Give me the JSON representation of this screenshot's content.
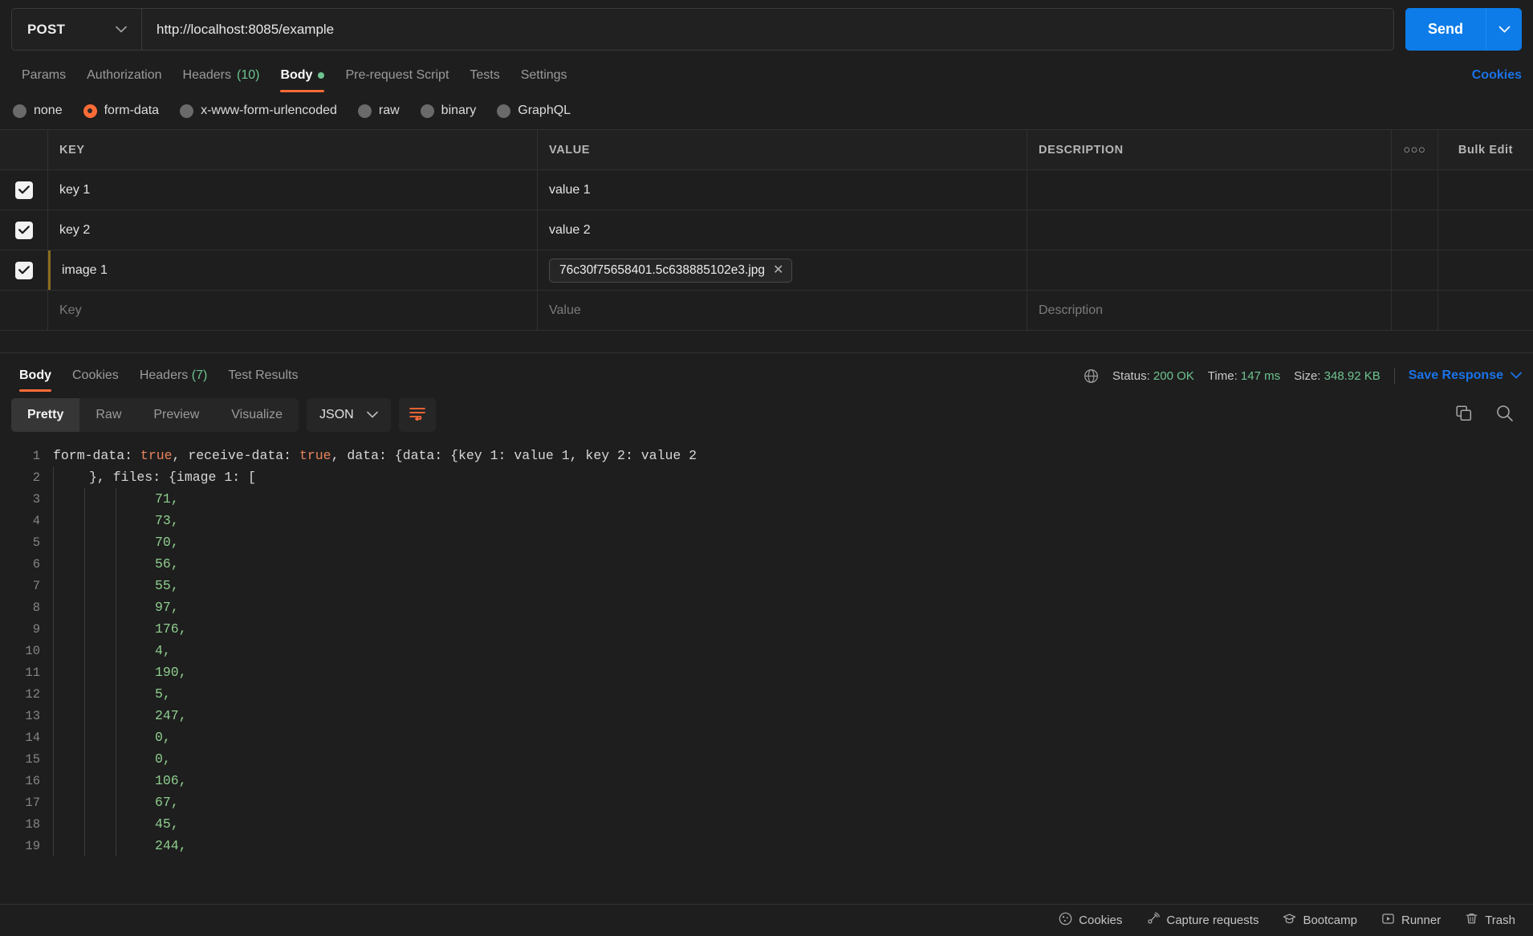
{
  "request": {
    "method": "POST",
    "url": "http://localhost:8085/example",
    "send_label": "Send",
    "tabs": [
      {
        "label": "Params",
        "count": "",
        "active": false,
        "dot": false
      },
      {
        "label": "Authorization",
        "count": "",
        "active": false,
        "dot": false
      },
      {
        "label": "Headers",
        "count": "(10)",
        "active": false,
        "dot": false
      },
      {
        "label": "Body",
        "count": "",
        "active": true,
        "dot": true
      },
      {
        "label": "Pre-request Script",
        "count": "",
        "active": false,
        "dot": false
      },
      {
        "label": "Tests",
        "count": "",
        "active": false,
        "dot": false
      },
      {
        "label": "Settings",
        "count": "",
        "active": false,
        "dot": false
      }
    ],
    "cookies_link": "Cookies",
    "body_types": [
      {
        "label": "none",
        "selected": false
      },
      {
        "label": "form-data",
        "selected": true
      },
      {
        "label": "x-www-form-urlencoded",
        "selected": false
      },
      {
        "label": "raw",
        "selected": false
      },
      {
        "label": "binary",
        "selected": false
      },
      {
        "label": "GraphQL",
        "selected": false
      }
    ]
  },
  "form_table": {
    "headers": {
      "key": "KEY",
      "value": "VALUE",
      "description": "DESCRIPTION"
    },
    "dots_label": "○○○",
    "bulk_edit_label": "Bulk Edit",
    "rows": [
      {
        "checked": true,
        "key": "key 1",
        "value": "value 1",
        "description": "",
        "is_file": false
      },
      {
        "checked": true,
        "key": "key 2",
        "value": "value 2",
        "description": "",
        "is_file": false
      },
      {
        "checked": true,
        "key": "image 1",
        "value": "76c30f75658401.5c638885102e3.jpg",
        "description": "",
        "is_file": true,
        "remove_label": "✕"
      }
    ],
    "placeholder_row": {
      "key": "Key",
      "value": "Value",
      "description": "Description"
    }
  },
  "response": {
    "tabs": [
      {
        "label": "Body",
        "count": "",
        "active": true
      },
      {
        "label": "Cookies",
        "count": "",
        "active": false
      },
      {
        "label": "Headers",
        "count": "(7)",
        "active": false
      },
      {
        "label": "Test Results",
        "count": "",
        "active": false
      }
    ],
    "status_label": "Status:",
    "status_value": "200 OK",
    "time_label": "Time:",
    "time_value": "147 ms",
    "size_label": "Size:",
    "size_value": "348.92 KB",
    "save_response_label": "Save Response",
    "view_modes": [
      {
        "label": "Pretty",
        "active": true
      },
      {
        "label": "Raw",
        "active": false
      },
      {
        "label": "Preview",
        "active": false
      },
      {
        "label": "Visualize",
        "active": false
      }
    ],
    "format": "JSON"
  },
  "body_code": {
    "line1_prefix": "form-data: ",
    "line1_true1": "true",
    "line1_mid": ", receive-data: ",
    "line1_true2": "true",
    "line1_suffix": ", data: {data: {key 1: value 1, key 2: value 2",
    "line2": "}, files: {image 1: [",
    "numbers": [
      71,
      73,
      70,
      56,
      55,
      97,
      176,
      4,
      190,
      5,
      247,
      0,
      0,
      106,
      67,
      45,
      244
    ]
  },
  "footer": {
    "items": [
      {
        "label": "Cookies",
        "icon": "cookie-icon"
      },
      {
        "label": "Capture requests",
        "icon": "satellite-icon"
      },
      {
        "label": "Bootcamp",
        "icon": "graduation-cap-icon"
      },
      {
        "label": "Runner",
        "icon": "play-box-icon"
      },
      {
        "label": "Trash",
        "icon": "trash-icon"
      }
    ]
  },
  "colors": {
    "accent": "#ff6c37",
    "link": "#1a73e8",
    "success": "#6ec490",
    "send": "#0d7ce8"
  }
}
